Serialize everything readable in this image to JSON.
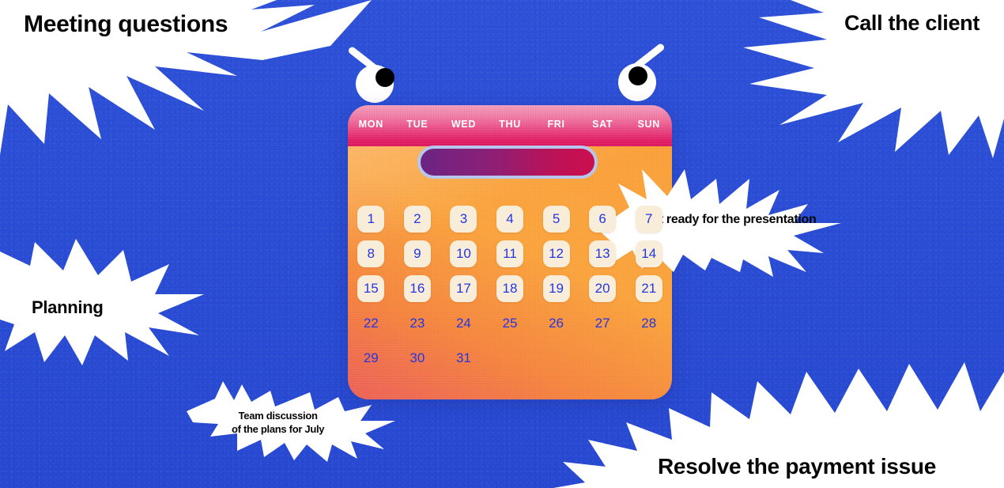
{
  "palette": {
    "background_blue": "#2d51da",
    "bubble_white": "#ffffff",
    "text_black": "#060606",
    "header_pink_top": "#f3a0bd",
    "header_pink_bottom": "#dc1860",
    "body_orange": "#fba13a",
    "body_coral": "#ec6257",
    "cell_cream": "#f7edd9",
    "date_blue": "#2536e0",
    "pill_purple": "#6b2483",
    "pill_crimson": "#cc0f4d",
    "pill_border": "#b8c6ee"
  },
  "notes": [
    {
      "id": "meeting-questions",
      "text": "Meeting questions"
    },
    {
      "id": "call-the-client",
      "text": "Call the client"
    },
    {
      "id": "planning",
      "text": "Planning"
    },
    {
      "id": "get-ready",
      "text": "Get ready for the presentation"
    },
    {
      "id": "team-discussion",
      "text": "Team discussion\nof the plans for July"
    },
    {
      "id": "resolve-payment",
      "text": "Resolve the payment issue"
    }
  ],
  "calendar": {
    "day_headers": [
      "MON",
      "TUE",
      "WED",
      "THU",
      "FRI",
      "SAT",
      "SUN"
    ],
    "search_value": "",
    "search_placeholder": "",
    "weeks": [
      [
        "1",
        "2",
        "3",
        "4",
        "5",
        "6",
        "7"
      ],
      [
        "8",
        "9",
        "10",
        "11",
        "12",
        "13",
        "14"
      ],
      [
        "15",
        "16",
        "17",
        "18",
        "19",
        "20",
        "21"
      ],
      [
        "22",
        "23",
        "24",
        "25",
        "26",
        "27",
        "28"
      ],
      [
        "29",
        "30",
        "31",
        "",
        "",
        "",
        ""
      ]
    ],
    "highlighted_through": 21
  },
  "face": {
    "left_eye": "eye-white",
    "left_pupil": "pupil-black",
    "right_eye": "eye-white",
    "right_pupil": "pupil-black",
    "left_brow": "eyebrow",
    "right_brow": "eyebrow"
  }
}
